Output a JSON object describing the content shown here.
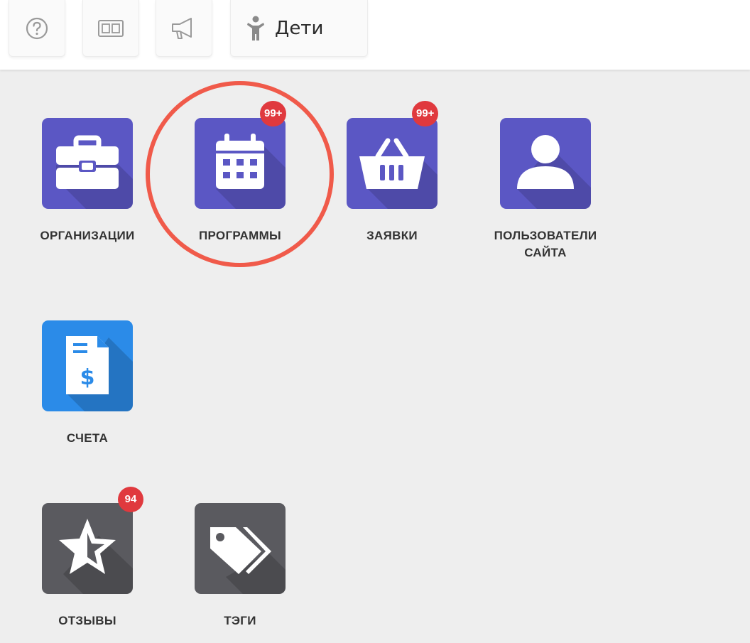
{
  "toolbar": {
    "help_icon": "help-circle-icon",
    "news_icon": "newspaper-icon",
    "announce_icon": "megaphone-icon",
    "child_icon": "child-icon",
    "section_label": "Дети"
  },
  "tiles": {
    "organizations": {
      "label": "ОРГАНИЗАЦИИ",
      "icon": "briefcase-icon",
      "color": "#5b57c4"
    },
    "programs": {
      "label": "ПРОГРАММЫ",
      "icon": "calendar-icon",
      "color": "#5b57c4",
      "badge": "99+"
    },
    "requests": {
      "label": "ЗАЯВКИ",
      "icon": "basket-icon",
      "color": "#5b57c4",
      "badge": "99+"
    },
    "site_users": {
      "label_line1": "ПОЛЬЗОВАТЕЛИ",
      "label_line2": "САЙТА",
      "icon": "user-icon",
      "color": "#5b57c4"
    },
    "invoices": {
      "label": "СЧЕТА",
      "icon": "invoice-icon",
      "color": "#2b8be8"
    },
    "reviews": {
      "label": "ОТЗЫВЫ",
      "icon": "star-icon",
      "color": "#5a5a5f",
      "badge": "94"
    },
    "tags": {
      "label": "ТЭГИ",
      "icon": "tags-icon",
      "color": "#5a5a5f"
    }
  },
  "colors": {
    "badge": "#e0393e",
    "highlight_ring": "#f05a4a",
    "background": "#eeeeee"
  }
}
